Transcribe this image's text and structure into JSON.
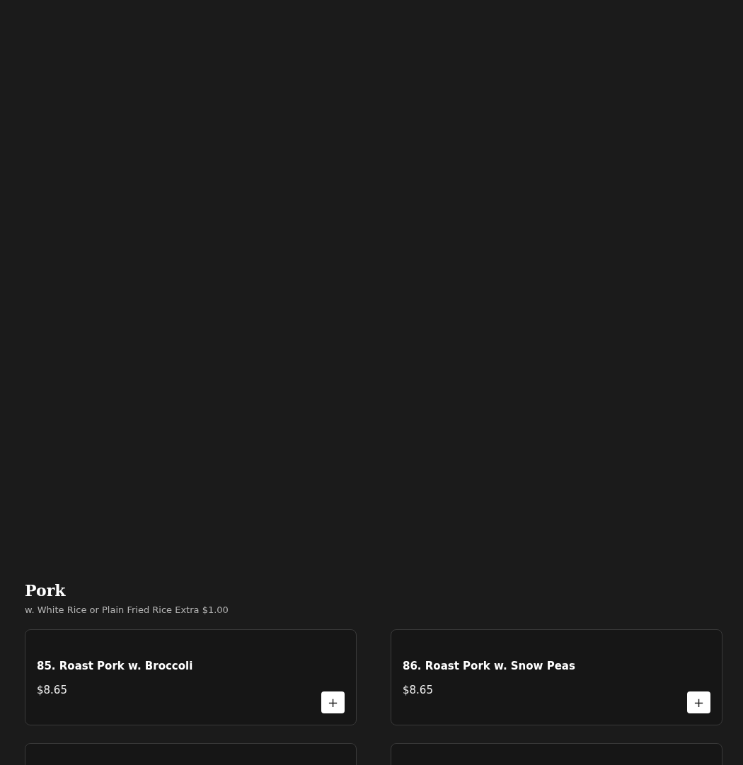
{
  "section": {
    "title": "Pork",
    "subtitle": "w. White Rice or Plain Fried Rice Extra $1.00"
  },
  "items": [
    {
      "kind": "dish",
      "name": "85. Roast Pork w. Broccoli",
      "price": "$8.65",
      "add": "+"
    },
    {
      "kind": "dish",
      "name": "86. Roast Pork w. Snow Peas",
      "price": "$8.65",
      "add": "+"
    },
    {
      "kind": "cut"
    },
    {
      "kind": "cut"
    }
  ]
}
